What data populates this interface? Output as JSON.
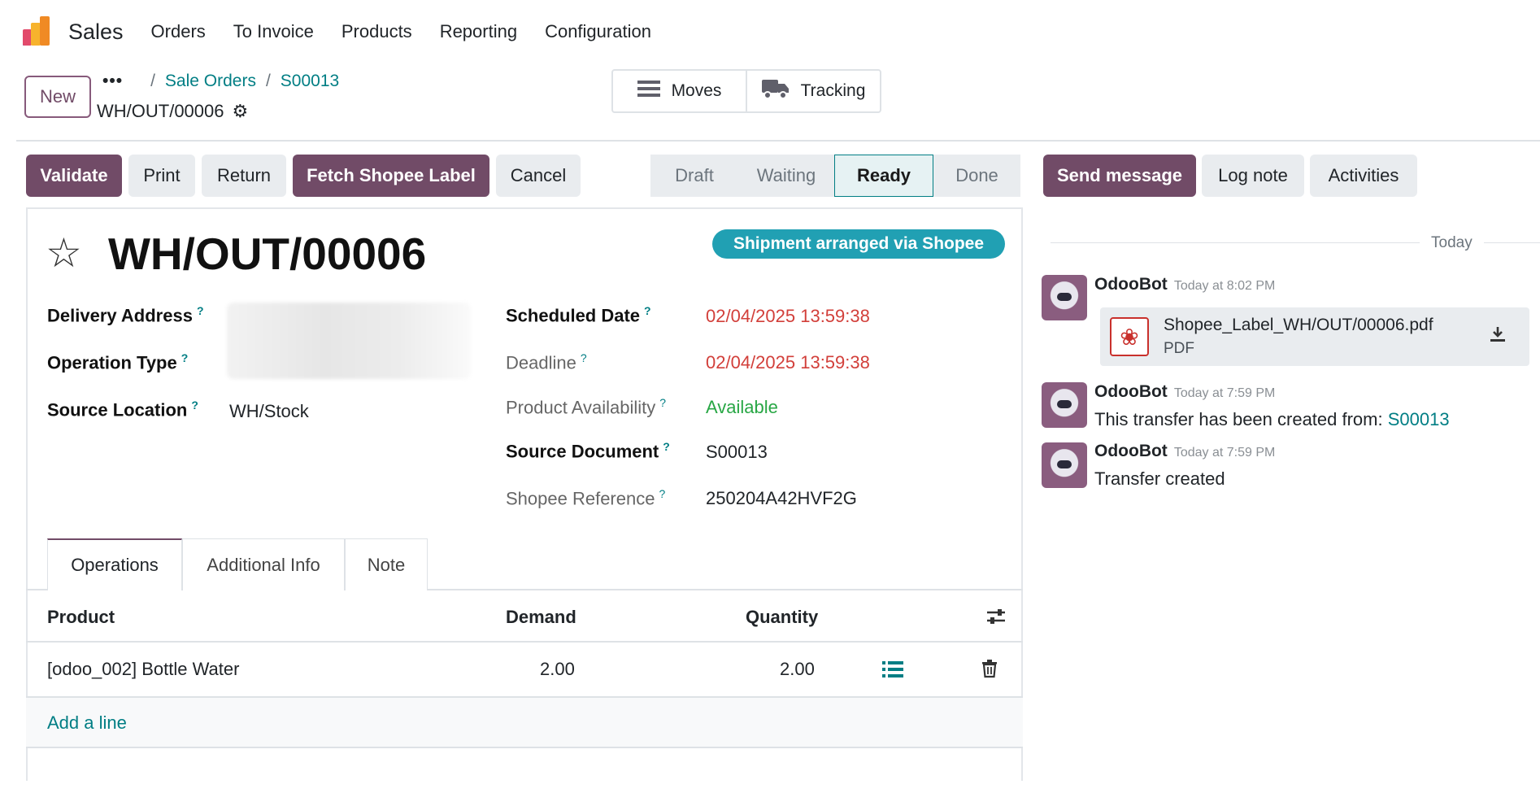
{
  "navbar": {
    "app_name": "Sales",
    "menu": [
      "Orders",
      "To Invoice",
      "Products",
      "Reporting",
      "Configuration"
    ]
  },
  "control_panel": {
    "new_label": "New",
    "breadcrumb_dots": "•••",
    "breadcrumbs": [
      "Sale Orders",
      "S00013"
    ],
    "breadcrumb_sep": "/",
    "record_name": "WH/OUT/00006",
    "smart_buttons": {
      "moves": "Moves",
      "tracking": "Tracking"
    }
  },
  "actions": {
    "validate": "Validate",
    "print": "Print",
    "return": "Return",
    "fetch_label": "Fetch Shopee Label",
    "cancel": "Cancel"
  },
  "status": {
    "stages": [
      "Draft",
      "Waiting",
      "Ready",
      "Done"
    ],
    "active": "Ready"
  },
  "chatter_buttons": {
    "send_message": "Send message",
    "log_note": "Log note",
    "activities": "Activities"
  },
  "form": {
    "title": "WH/OUT/00006",
    "badge": "Shipment arranged via Shopee",
    "help_mark": "?",
    "left": {
      "delivery_address_label": "Delivery Address",
      "operation_type_label": "Operation Type",
      "source_location_label": "Source Location",
      "source_location_value": "WH/Stock"
    },
    "right": {
      "scheduled_date_label": "Scheduled Date",
      "scheduled_date_value": "02/04/2025 13:59:38",
      "deadline_label": "Deadline",
      "deadline_value": "02/04/2025 13:59:38",
      "availability_label": "Product Availability",
      "availability_value": "Available",
      "source_document_label": "Source Document",
      "source_document_value": "S00013",
      "shopee_ref_label": "Shopee Reference",
      "shopee_ref_value": "250204A42HVF2G"
    },
    "tabs": [
      "Operations",
      "Additional Info",
      "Note"
    ],
    "table": {
      "headers": {
        "product": "Product",
        "demand": "Demand",
        "quantity": "Quantity"
      },
      "rows": [
        {
          "product": "[odoo_002] Bottle Water",
          "demand": "2.00",
          "quantity": "2.00"
        }
      ],
      "add_line": "Add a line"
    }
  },
  "chatter": {
    "today": "Today",
    "messages": [
      {
        "author": "OdooBot",
        "time": "Today at 8:02 PM"
      },
      {
        "author": "OdooBot",
        "time": "Today at 7:59 PM",
        "body": "This transfer has been created from:",
        "link": "S00013"
      },
      {
        "author": "OdooBot",
        "time": "Today at 7:59 PM",
        "body": "Transfer created"
      }
    ],
    "attachment": {
      "name": "Shopee_Label_WH/OUT/00006.pdf",
      "type": "PDF"
    }
  },
  "colors": {
    "primary": "#714b67",
    "link": "#017e84",
    "badge": "#21a0b3",
    "date_red": "#d23f3a",
    "available_green": "#28a745"
  }
}
